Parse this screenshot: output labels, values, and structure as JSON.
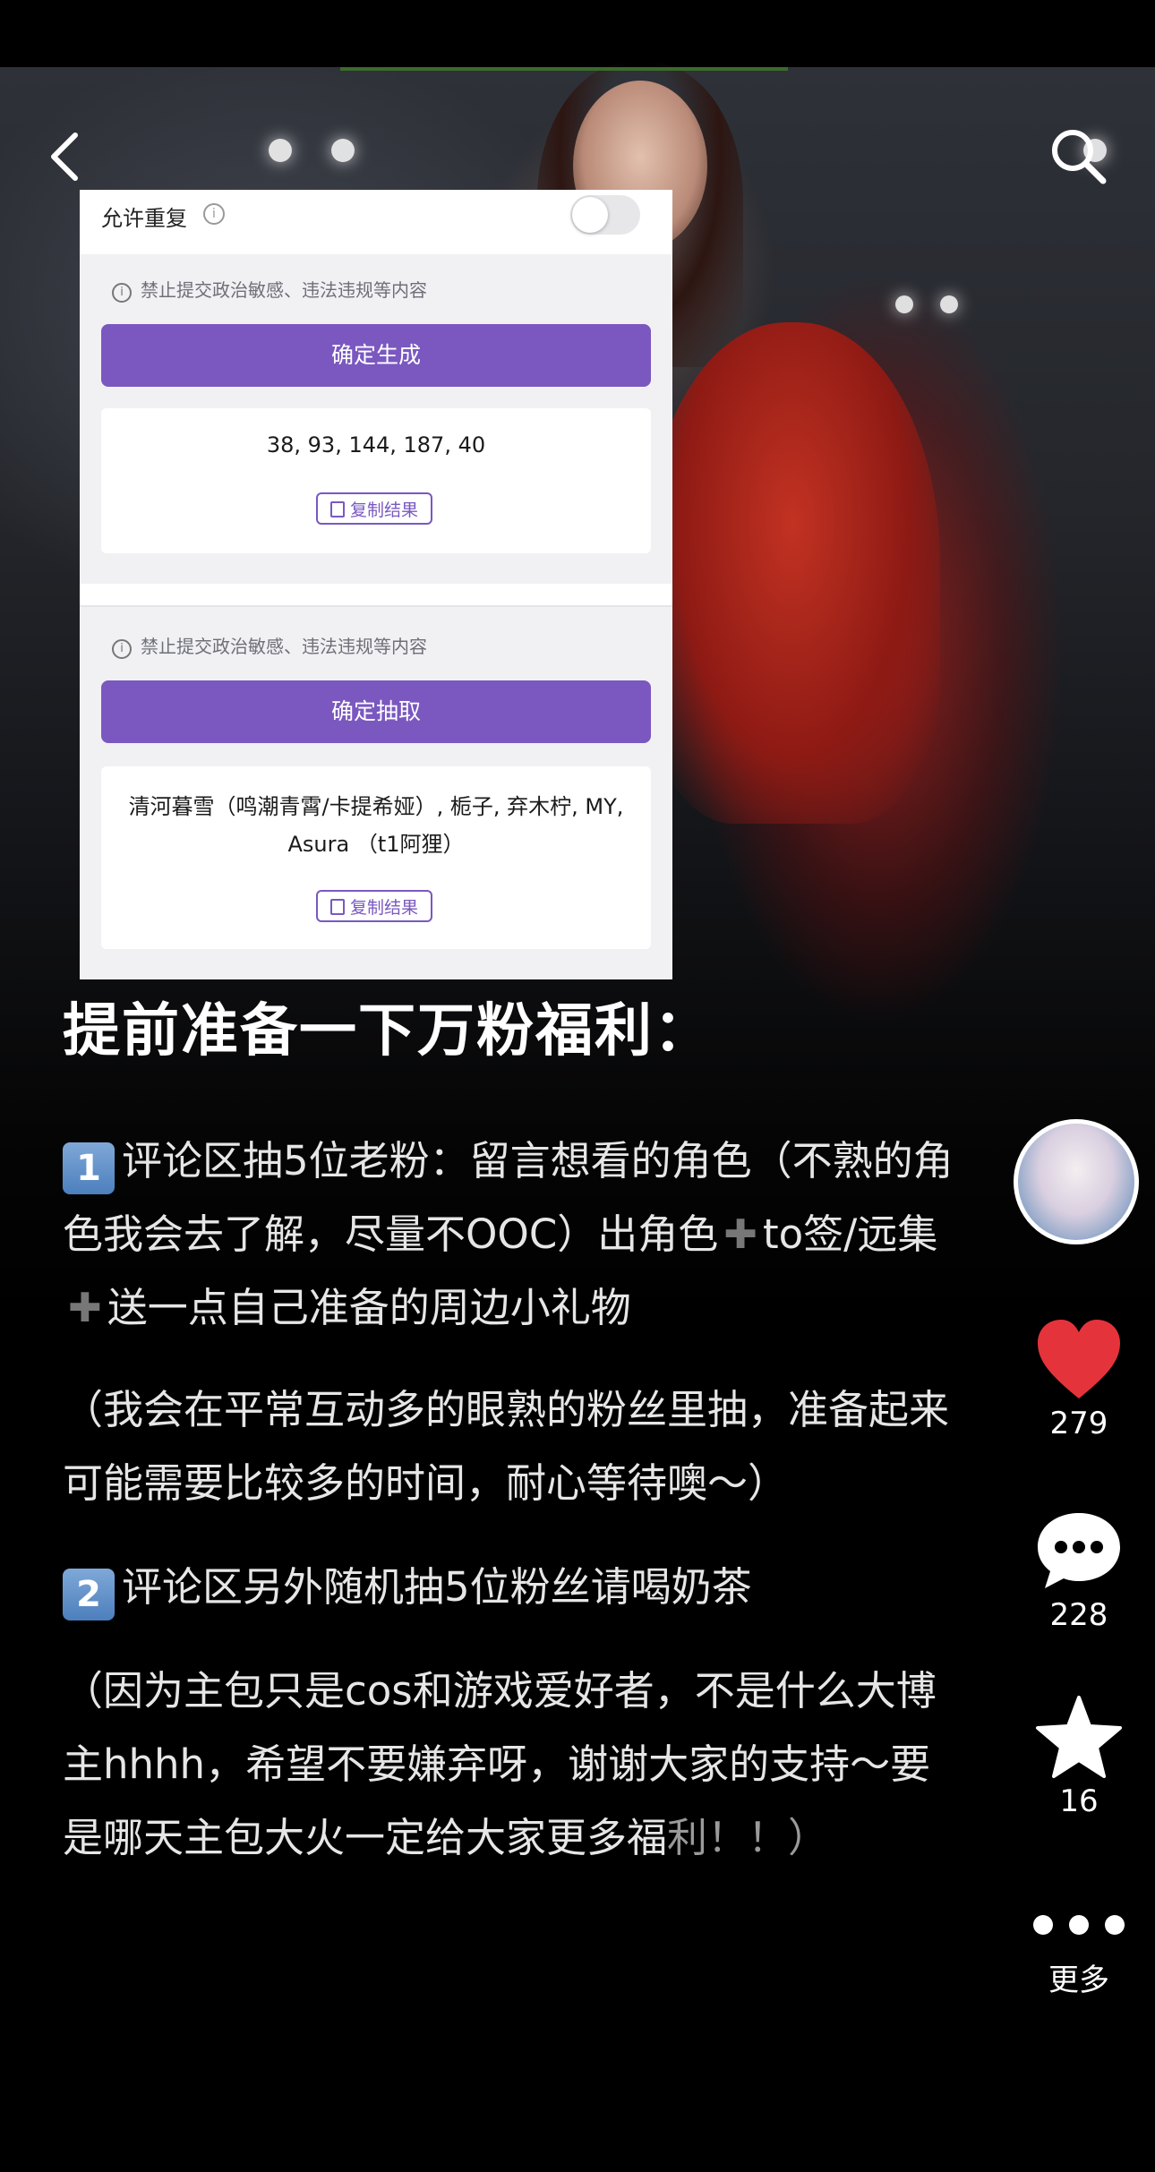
{
  "nav": {
    "back_icon": "chevron-left-icon",
    "search_icon": "search-icon"
  },
  "card": {
    "allow_repeat_label": "允许重复",
    "allow_repeat_on": false,
    "notice_1": "禁止提交政治敏感、违法违规等内容",
    "generate_button": "确定生成",
    "result_1": "38, 93, 144, 187, 40",
    "copy_label": "复制结果",
    "notice_2": "禁止提交政治敏感、违法违规等内容",
    "draw_button": "确定抽取",
    "result_2": "清河暮雪（鸣潮青霄/卡提希娅）, 栀子, 弃木柠, MY, Asura （t1阿狸）",
    "copy_label_2": "复制结果"
  },
  "post": {
    "title": "提前准备一下万粉福利：",
    "item1_badge": "1",
    "item1_a": "评论区抽5位老粉：留言想看的角色（不熟的角色我会去了解，尽量不OOC）出角色",
    "item1_b": "to签/远集",
    "item1_c": "送一点自己准备的周边小礼物",
    "note1": "（我会在平常互动多的眼熟的粉丝里抽，准备起来可能需要比较多的时间，耐心等待噢～）",
    "item2_badge": "2",
    "item2": "评论区另外随机抽5位粉丝请喝奶茶",
    "note2_main": "（因为主包只是cos和游戏爱好者，不是什么大博主hhhh，希望不要嫌弃呀，谢谢大家的支持～要是哪天主包大火一定给大家更多福",
    "note2_tail": "利！！）"
  },
  "sidebar": {
    "likes": "279",
    "comments": "228",
    "favorites": "16",
    "more_label": "更多",
    "like_color": "#e5333b"
  }
}
